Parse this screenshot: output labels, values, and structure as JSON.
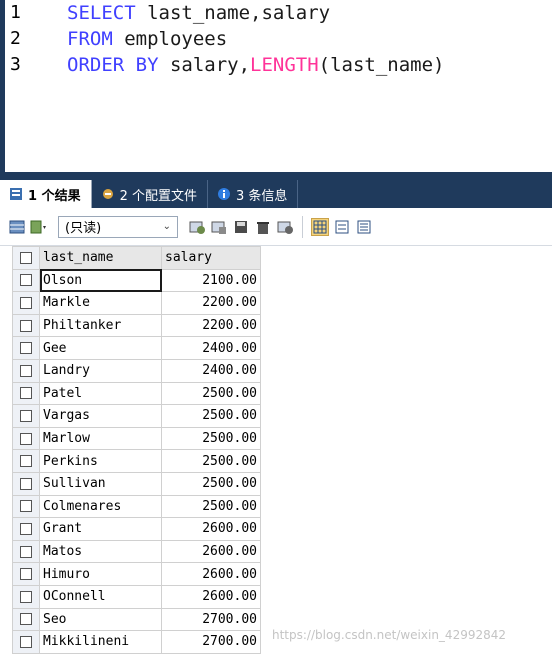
{
  "editor": {
    "line_numbers": [
      "1",
      "2",
      "3"
    ],
    "line1": {
      "kw": "SELECT",
      "rest": " last_name,salary"
    },
    "line2": {
      "kw": "FROM",
      "rest": " employees"
    },
    "line3": {
      "kw": "ORDER BY",
      "rest1": " salary,",
      "fn": "LENGTH",
      "rest2": "(last_name)"
    }
  },
  "tabs": [
    {
      "label": "1 个结果"
    },
    {
      "label": "2 个配置文件"
    },
    {
      "label": "3 条信息"
    }
  ],
  "toolbar": {
    "mode_value": "(只读)"
  },
  "grid": {
    "headers": [
      "last_name",
      "salary"
    ],
    "rows": [
      [
        "Olson",
        "2100.00"
      ],
      [
        "Markle",
        "2200.00"
      ],
      [
        "Philtanker",
        "2200.00"
      ],
      [
        "Gee",
        "2400.00"
      ],
      [
        "Landry",
        "2400.00"
      ],
      [
        "Patel",
        "2500.00"
      ],
      [
        "Vargas",
        "2500.00"
      ],
      [
        "Marlow",
        "2500.00"
      ],
      [
        "Perkins",
        "2500.00"
      ],
      [
        "Sullivan",
        "2500.00"
      ],
      [
        "Colmenares",
        "2500.00"
      ],
      [
        "Grant",
        "2600.00"
      ],
      [
        "Matos",
        "2600.00"
      ],
      [
        "Himuro",
        "2600.00"
      ],
      [
        "OConnell",
        "2600.00"
      ],
      [
        "Seo",
        "2700.00"
      ],
      [
        "Mikkilineni",
        "2700.00"
      ]
    ]
  },
  "watermark": "https://blog.csdn.net/weixin_42992842",
  "colors": {
    "keyword": "#4040ff",
    "function": "#ff3399",
    "chrome": "#1f3a5c"
  }
}
